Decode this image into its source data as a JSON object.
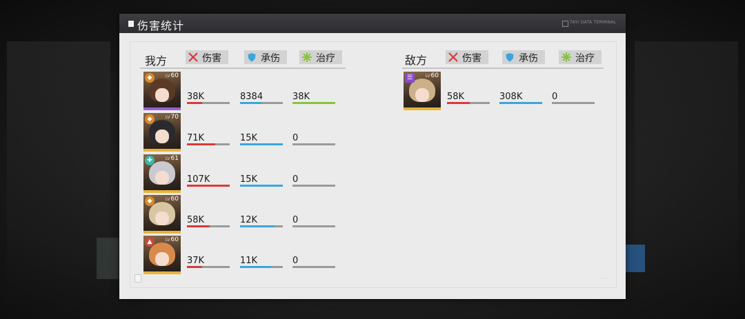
{
  "window": {
    "title": "伤害统计",
    "terminal_label": "TAYI DATA TERMINAL"
  },
  "headers": {
    "damage": "伤害",
    "taken": "承伤",
    "heal": "治疗"
  },
  "ally": {
    "label": "我方",
    "members": [
      {
        "level": "60",
        "damage": "38K",
        "taken": "8384",
        "heal": "38K",
        "damage_fill": 0.35,
        "taken_fill": 0.5,
        "heal_fill": 1.0,
        "badge_color": "#d98a2a",
        "stripe_color": "#9a5fd1",
        "hair_color": "#5a3a26"
      },
      {
        "level": "70",
        "damage": "71K",
        "taken": "15K",
        "heal": "0",
        "damage_fill": 0.66,
        "taken_fill": 1.0,
        "heal_fill": 0,
        "badge_color": "#d98a2a",
        "stripe_color": "#e6b43a",
        "hair_color": "#2a2a2e"
      },
      {
        "level": "61",
        "damage": "107K",
        "taken": "15K",
        "heal": "0",
        "damage_fill": 1.0,
        "taken_fill": 1.0,
        "heal_fill": 0,
        "badge_color": "#3ab6a8",
        "stripe_color": "#e6b43a",
        "hair_color": "#c9c9cf"
      },
      {
        "level": "60",
        "damage": "58K",
        "taken": "12K",
        "heal": "0",
        "damage_fill": 0.54,
        "taken_fill": 0.8,
        "heal_fill": 0,
        "badge_color": "#d98a2a",
        "stripe_color": "#e6b43a",
        "hair_color": "#d8c6a2"
      },
      {
        "level": "60",
        "damage": "37K",
        "taken": "11K",
        "heal": "0",
        "damage_fill": 0.35,
        "taken_fill": 0.73,
        "heal_fill": 0,
        "badge_color": "#c94a3a",
        "stripe_color": "#e6b43a",
        "hair_color": "#d88a4a"
      }
    ]
  },
  "enemy": {
    "label": "敌方",
    "members": [
      {
        "level": "60",
        "damage": "58K",
        "taken": "308K",
        "heal": "0",
        "damage_fill": 0.54,
        "taken_fill": 1.0,
        "heal_fill": 0,
        "badge_color": "#8a4ad1",
        "stripe_color": "#e6b43a",
        "hair_color": "#cbb08a"
      }
    ]
  },
  "colors": {
    "damage": "#d93a3a",
    "taken": "#3aa6dd",
    "heal": "#86c43a"
  }
}
